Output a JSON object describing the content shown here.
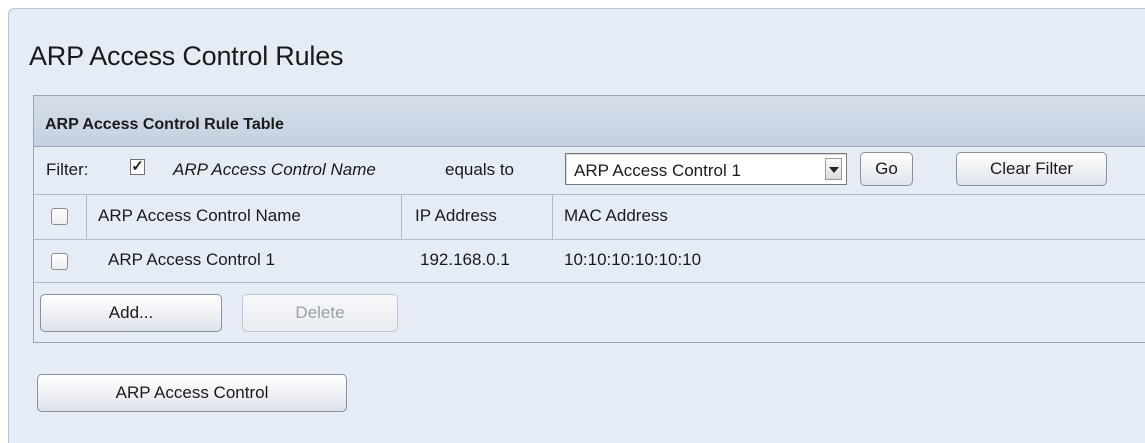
{
  "page": {
    "title": "ARP Access Control Rules"
  },
  "table_panel": {
    "title": "ARP Access Control Rule Table",
    "filter": {
      "label": "Filter:",
      "checked": true,
      "checkmark": "✓",
      "field_name": "ARP Access Control Name",
      "operator": "equals to",
      "selected_value": "ARP Access Control 1",
      "go_label": "Go",
      "clear_label": "Clear Filter"
    },
    "columns": [
      "ARP Access Control Name",
      "IP Address",
      "MAC Address"
    ],
    "rows": [
      {
        "checked": false,
        "name": "ARP Access Control 1",
        "ip": "192.168.0.1",
        "mac": "10:10:10:10:10:10"
      }
    ],
    "add_label": "Add...",
    "delete_label": "Delete"
  },
  "footer": {
    "arp_access_control_label": "ARP Access Control"
  },
  "colors": {
    "page_background": "#e6ecf6",
    "panel_header": "#c6d0e0",
    "border": "#9aa6bb"
  }
}
